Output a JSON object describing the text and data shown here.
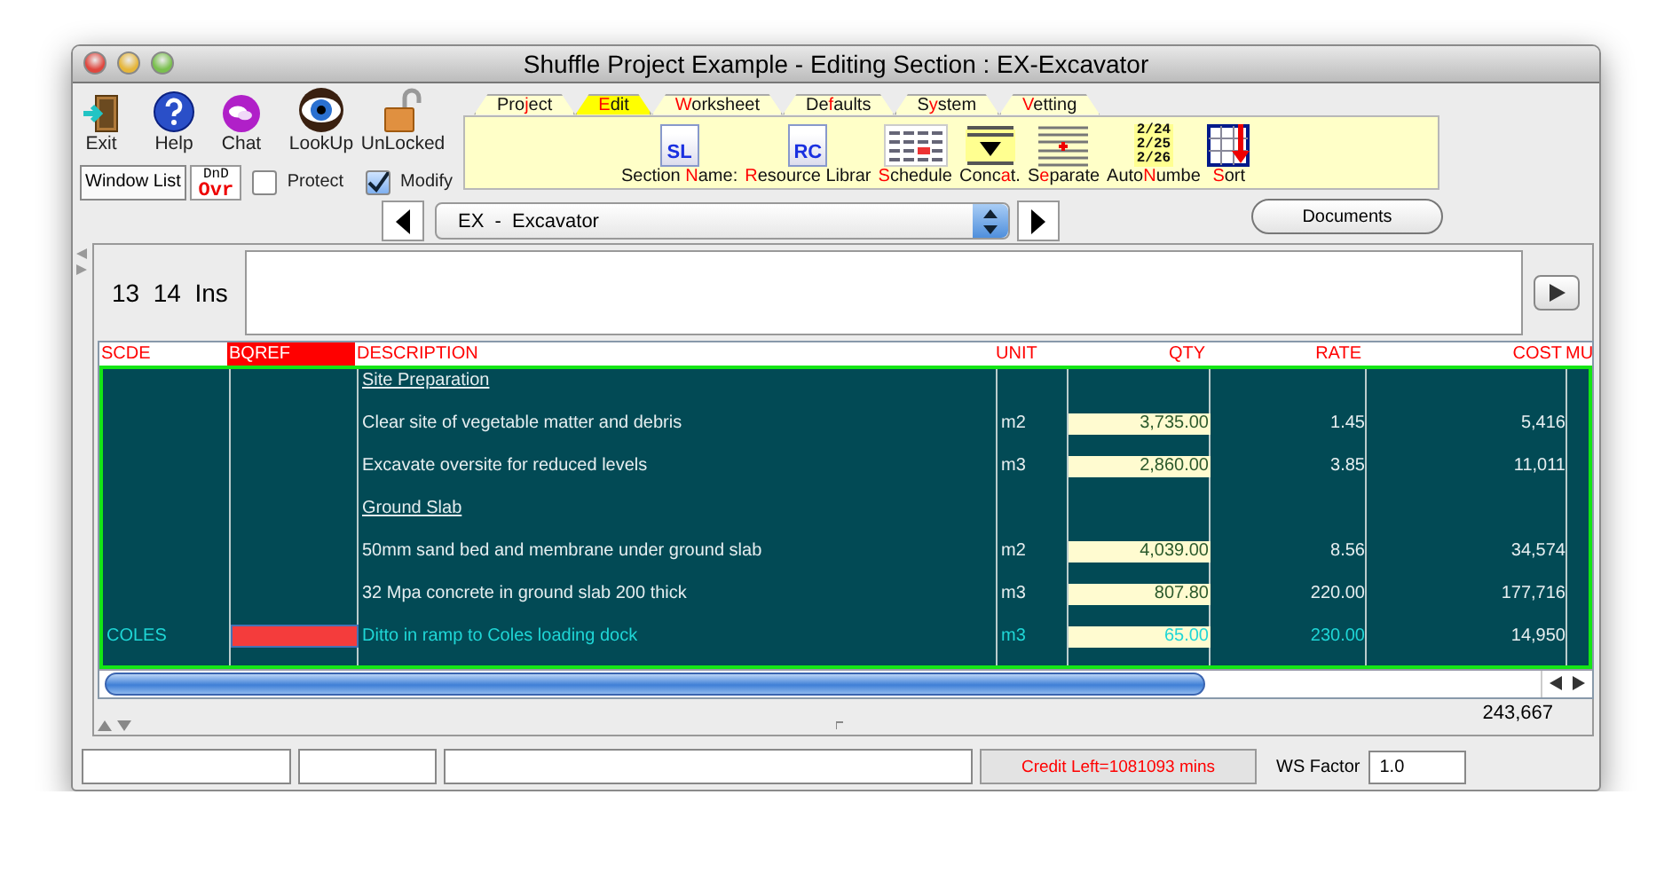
{
  "window": {
    "title": "Shuffle Project Example - Editing Section : EX-Excavator"
  },
  "toolbar": {
    "buttons": [
      {
        "kind": "exit",
        "label": "Exit"
      },
      {
        "kind": "help",
        "label": "Help"
      },
      {
        "kind": "chat",
        "label": "Chat"
      },
      {
        "kind": "lookup",
        "label": "LookUp"
      },
      {
        "kind": "lock",
        "label": "UnLocked"
      }
    ],
    "window_list_button": "Window List",
    "dnd_badge": {
      "top": "DnD",
      "bottom": "Ovr"
    },
    "checkboxes": [
      {
        "label": "Protect",
        "checked": false
      },
      {
        "label": "Modify",
        "checked": true
      }
    ]
  },
  "tabs": [
    {
      "parts": {
        "before": "Pro",
        "key": "j",
        "after": "ect"
      },
      "selected": false
    },
    {
      "parts": {
        "key": "E",
        "after": "dit"
      },
      "selected": true
    },
    {
      "parts": {
        "key": "W",
        "after": "orksheet"
      },
      "selected": false
    },
    {
      "parts": {
        "before": "De",
        "key": "f",
        "after": "aults"
      },
      "selected": false
    },
    {
      "parts": {
        "before": "S",
        "key": "y",
        "after": "stem"
      },
      "selected": false
    },
    {
      "parts": {
        "key": "V",
        "after": "etting"
      },
      "selected": false
    }
  ],
  "tools": [
    {
      "kind": "section",
      "icon_text": "SL",
      "parts": {
        "before": "Section ",
        "key": "N",
        "after": "ame:"
      }
    },
    {
      "kind": "resource",
      "icon_text": "RC",
      "parts": {
        "key": "R",
        "after": "esource Librar"
      }
    },
    {
      "kind": "schedule",
      "parts": {
        "key": "S",
        "after": "chedule"
      }
    },
    {
      "kind": "concat",
      "parts": {
        "before": "Conc",
        "key": "a",
        "after": "t."
      }
    },
    {
      "kind": "separate",
      "parts": {
        "before": "S",
        "key": "e",
        "after": "parate"
      }
    },
    {
      "kind": "autonumber",
      "icon_lines": [
        "2/24",
        "2/25",
        "2/26"
      ],
      "parts": {
        "before": "Auto",
        "key": "N",
        "after": "umbe"
      }
    },
    {
      "kind": "sort",
      "parts": {
        "key": "S",
        "after": "ort"
      }
    }
  ],
  "section_selector": {
    "value": "EX  -  Excavator",
    "documents_button": "Documents"
  },
  "editor": {
    "position": "13  14  Ins"
  },
  "grid": {
    "columns": [
      {
        "label": "SCDE",
        "highlighted": false
      },
      {
        "label": "BQREF",
        "highlighted": true
      },
      {
        "label": "DESCRIPTION",
        "highlighted": false
      },
      {
        "label": "UNIT",
        "highlighted": false
      },
      {
        "label": "QTY",
        "highlighted": false
      },
      {
        "label": "RATE",
        "highlighted": false
      },
      {
        "label": "COST",
        "highlighted": false
      },
      {
        "label": "MU",
        "highlighted": false
      }
    ],
    "rows": [
      {
        "kind": "heading",
        "description": "Site Preparation",
        "highlighted": false
      },
      {
        "kind": "item",
        "description": "Clear site of vegetable matter and debris",
        "unit": "m2",
        "qty": "3,735.00",
        "rate": "1.45",
        "cost": "5,416",
        "highlighted": false
      },
      {
        "kind": "item",
        "description": "Excavate oversite for reduced levels",
        "unit": "m3",
        "qty": "2,860.00",
        "rate": "3.85",
        "cost": "11,011",
        "highlighted": false
      },
      {
        "kind": "heading",
        "description": "Ground Slab",
        "highlighted": false
      },
      {
        "kind": "item",
        "description": "50mm sand bed and membrane under ground slab",
        "unit": "m2",
        "qty": "4,039.00",
        "rate": "8.56",
        "cost": "34,574",
        "highlighted": false
      },
      {
        "kind": "item",
        "description": "32 Mpa concrete in ground slab 200 thick",
        "unit": "m3",
        "qty": "807.80",
        "rate": "220.00",
        "cost": "177,716",
        "highlighted": false
      },
      {
        "kind": "item",
        "scde": "COLES",
        "description": "Ditto in ramp to Coles loading dock",
        "unit": "m3",
        "qty": "65.00",
        "rate": "230.00",
        "cost": "14,950",
        "highlighted": true
      }
    ],
    "total": "243,667"
  },
  "status_bar": {
    "credit": "Credit Left=1081093 mins",
    "ws_factor": {
      "label": "WS Factor",
      "value": "1.0"
    }
  }
}
